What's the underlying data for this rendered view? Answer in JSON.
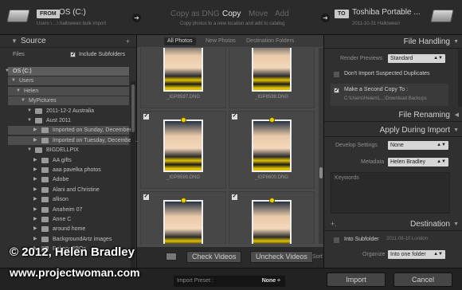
{
  "topbar": {
    "from_label": "FROM",
    "source_name": "OS (C:)",
    "source_sub": "Users \\ ...\\ halloween bulk import",
    "modes": {
      "dng": "Copy as DNG",
      "copy": "Copy",
      "move": "Move",
      "add": "Add"
    },
    "mode_sub": "Copy photos to a new location and add to catalog",
    "to_label": "TO",
    "dest_name": "Toshiba Portable ...",
    "dest_sub": "2011-10-31 Halloween"
  },
  "left_panel": {
    "title": "Source",
    "files_label": "Files",
    "include_subfolders": "Include Subfolders",
    "tree": [
      {
        "label": "OS (C:)",
        "level": 0,
        "state": "sel"
      },
      {
        "label": "Users",
        "level": 1,
        "state": "hl"
      },
      {
        "label": "Helen",
        "level": 2,
        "state": "hl"
      },
      {
        "label": "MyPictures",
        "level": 3,
        "state": "hl"
      },
      {
        "label": "2011-12-2 Australia",
        "level": 4,
        "state": ""
      },
      {
        "label": "Aust 2011",
        "level": 4,
        "state": ""
      },
      {
        "label": "Imported on Sunday, December...",
        "level": 5,
        "state": "hl"
      },
      {
        "label": "Imported on Tuesday, December...",
        "level": 5,
        "state": "hl"
      },
      {
        "label": "BIGDELLPIX",
        "level": 4,
        "state": ""
      },
      {
        "label": "AA gifts",
        "level": 5,
        "state": ""
      },
      {
        "label": "aaa pavelka photos",
        "level": 5,
        "state": ""
      },
      {
        "label": "Adobe",
        "level": 5,
        "state": ""
      },
      {
        "label": "Alani and Christine",
        "level": 5,
        "state": ""
      },
      {
        "label": "allison",
        "level": 5,
        "state": ""
      },
      {
        "label": "Anaheim 07",
        "level": 5,
        "state": ""
      },
      {
        "label": "Anne C",
        "level": 5,
        "state": ""
      },
      {
        "label": "around home",
        "level": 5,
        "state": ""
      },
      {
        "label": "BackgroundArtz images",
        "level": 5,
        "state": ""
      },
      {
        "label": "Bakery BBQs",
        "level": 5,
        "state": ""
      }
    ]
  },
  "center": {
    "tabs": {
      "all": "All Photos",
      "new": "New Photos",
      "dest": "Destination Folders"
    },
    "photos": [
      "_IGP8597.DNG",
      "_IGP8598.DNG",
      "_IGP8599.DNG",
      "_IGP8600.DNG",
      "",
      ""
    ],
    "check_videos": "Check Videos",
    "uncheck_videos": "Uncheck Videos",
    "sort_label": "Sort"
  },
  "right_panel": {
    "file_handling": "File Handling",
    "render_previews_label": "Render Previews",
    "render_previews_value": "Standard",
    "dont_import_label": "Don't Import Suspected Duplicates",
    "second_copy_label": "Make a Second Copy To :",
    "second_copy_path": "C:\\Users\\Helen\\L...\\Download Backups",
    "file_renaming": "File Renaming",
    "apply_during_import": "Apply During Import",
    "develop_label": "Develop Settings",
    "develop_value": "None",
    "metadata_label": "Metadata",
    "metadata_value": "Helen Bradley",
    "keywords_label": "Keywords",
    "destination": "Destination",
    "into_subfolder_label": "Into Subfolder",
    "into_subfolder_value": "2011-08-10 London",
    "organize_label": "Organize",
    "organize_value": "Into one folder"
  },
  "bottom": {
    "import_preset_label": "Import Preset :",
    "import_preset_value": "None ÷",
    "import_button": "Import",
    "cancel_button": "Cancel"
  },
  "watermark": {
    "line1": "© 2012, Helen Bradley",
    "line2": "www.projectwoman.com"
  }
}
